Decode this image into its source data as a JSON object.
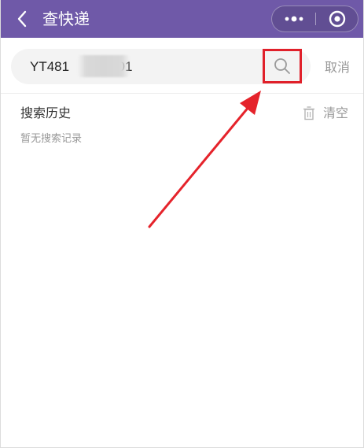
{
  "header": {
    "title": "查快递",
    "back_icon": "chevron-left-icon",
    "more_icon": "ellipsis-icon",
    "close_icon": "target-circle-icon",
    "background_color": "#6f59a8"
  },
  "search": {
    "value": "YT481           301",
    "search_icon": "search-icon",
    "cancel_label": "取消"
  },
  "history": {
    "title": "搜索历史",
    "clear_label": "清空",
    "clear_icon": "trash-icon",
    "empty_text": "暂无搜索记录"
  },
  "annotation": {
    "highlight_color": "#e0202a"
  }
}
